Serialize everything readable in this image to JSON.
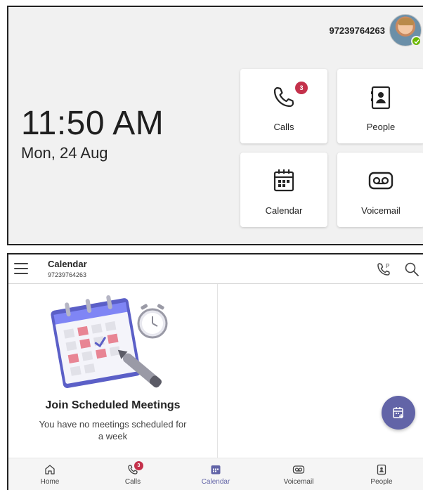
{
  "home": {
    "phone_number": "97239764263",
    "time": "11:50 AM",
    "date": "Mon, 24 Aug",
    "tiles": [
      {
        "label": "Calls",
        "icon": "phone-icon",
        "badge": "3"
      },
      {
        "label": "People",
        "icon": "contact-card-icon"
      },
      {
        "label": "Calendar",
        "icon": "calendar-icon"
      },
      {
        "label": "Voicemail",
        "icon": "voicemail-icon"
      }
    ],
    "presence": "available"
  },
  "calendar": {
    "title": "Calendar",
    "subtitle": "97239764263",
    "header_actions": [
      "park-call-icon",
      "search-icon"
    ],
    "empty_title": "Join Scheduled Meetings",
    "empty_subtitle": "You have no meetings scheduled for a week",
    "fab_icon": "add-calendar-event-icon"
  },
  "bottom_nav": [
    {
      "label": "Home",
      "icon": "home-icon"
    },
    {
      "label": "Calls",
      "icon": "phone-icon",
      "badge": "3"
    },
    {
      "label": "Calendar",
      "icon": "calendar-icon",
      "active": true
    },
    {
      "label": "Voicemail",
      "icon": "voicemail-icon"
    },
    {
      "label": "People",
      "icon": "contact-card-icon"
    }
  ],
  "colors": {
    "accent": "#6264a7",
    "badge": "#c4314b",
    "presence_available": "#6bb700",
    "home_background": "#f1f1f1"
  }
}
